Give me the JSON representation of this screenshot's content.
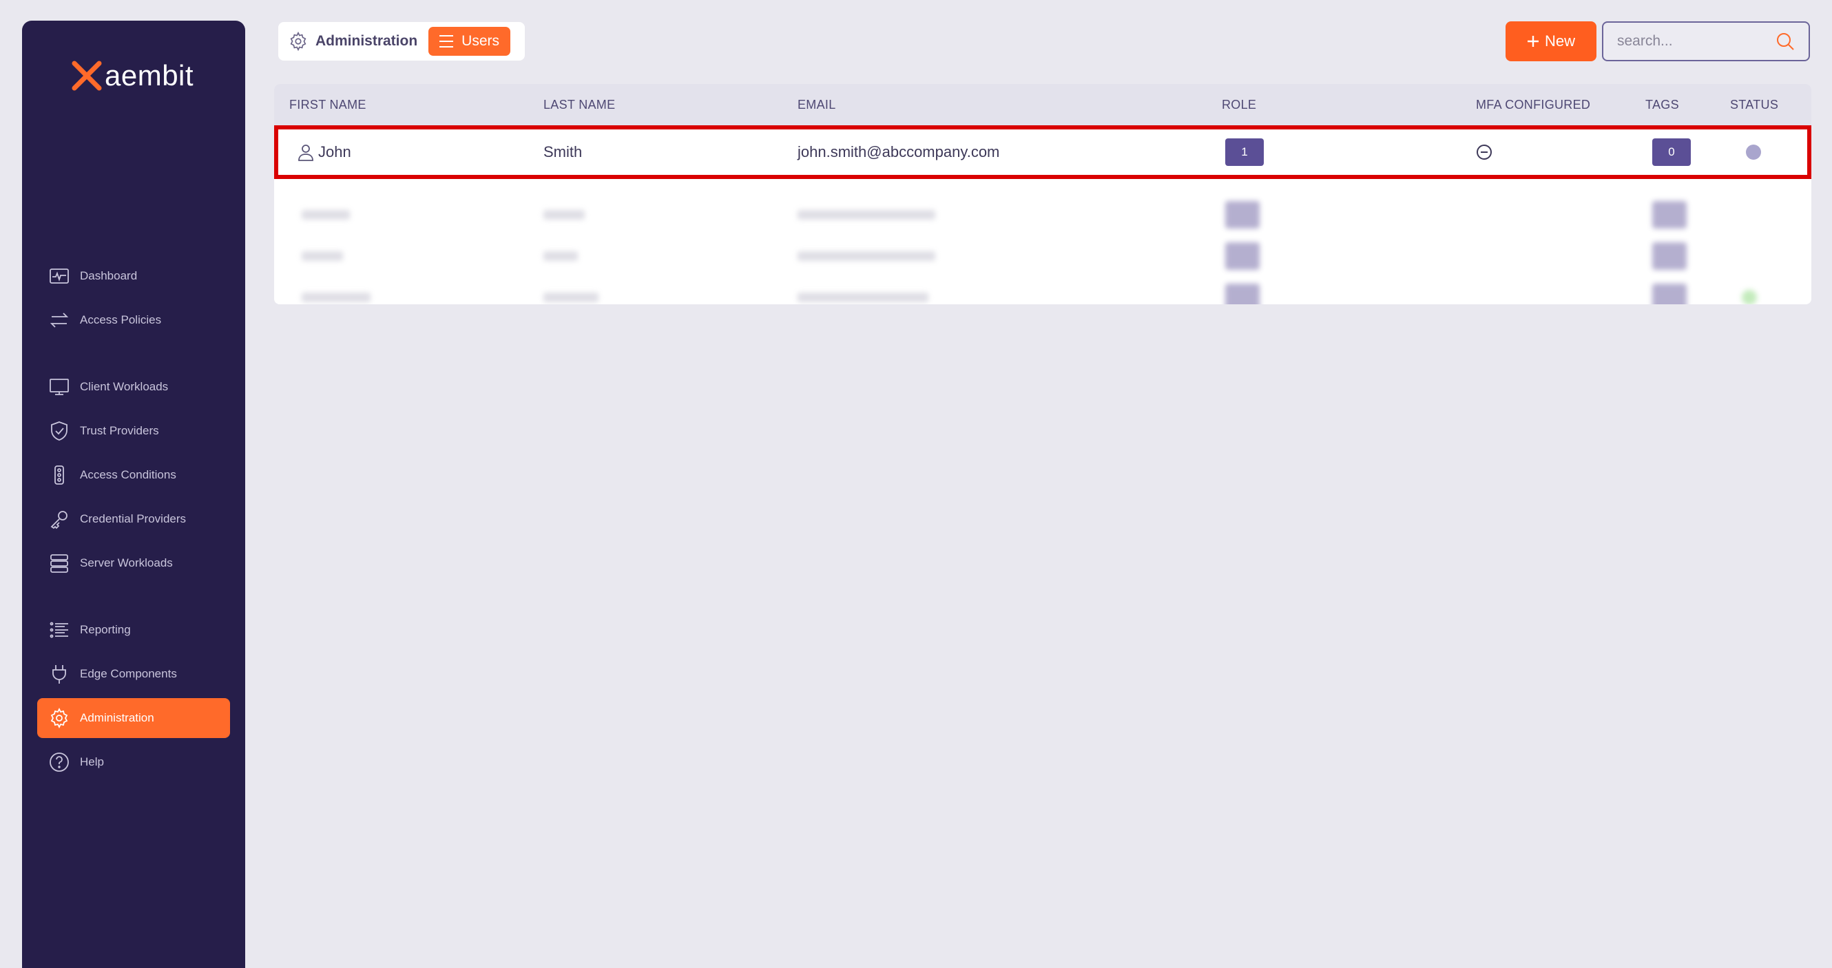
{
  "brand": {
    "name": "aembit",
    "accent": "#ff6a2a",
    "sidebar_bg": "#261e4a"
  },
  "sidebar": {
    "items": [
      {
        "label": "Dashboard",
        "icon": "activity-monitor-icon"
      },
      {
        "label": "Access Policies",
        "icon": "arrows-exchange-icon"
      },
      {
        "label": "Client Workloads",
        "icon": "monitor-icon"
      },
      {
        "label": "Trust Providers",
        "icon": "shield-check-icon"
      },
      {
        "label": "Access Conditions",
        "icon": "traffic-light-icon"
      },
      {
        "label": "Credential Providers",
        "icon": "key-icon"
      },
      {
        "label": "Server Workloads",
        "icon": "server-icon"
      },
      {
        "label": "Reporting",
        "icon": "list-icon"
      },
      {
        "label": "Edge Components",
        "icon": "plug-icon"
      },
      {
        "label": "Administration",
        "icon": "gear-icon",
        "active": true
      },
      {
        "label": "Help",
        "icon": "help-circle-icon"
      }
    ]
  },
  "header": {
    "breadcrumb_section": "Administration",
    "breadcrumb_page": "Users",
    "new_button": "New",
    "search_placeholder": "search..."
  },
  "table": {
    "columns": [
      "FIRST NAME",
      "LAST NAME",
      "EMAIL",
      "ROLE",
      "MFA CONFIGURED",
      "TAGS",
      "STATUS"
    ],
    "rows": [
      {
        "first_name": "John",
        "last_name": "Smith",
        "email": "john.smith@abccompany.com",
        "role": "1",
        "mfa": "not-configured",
        "tags": "0",
        "status": "inactive"
      }
    ]
  }
}
